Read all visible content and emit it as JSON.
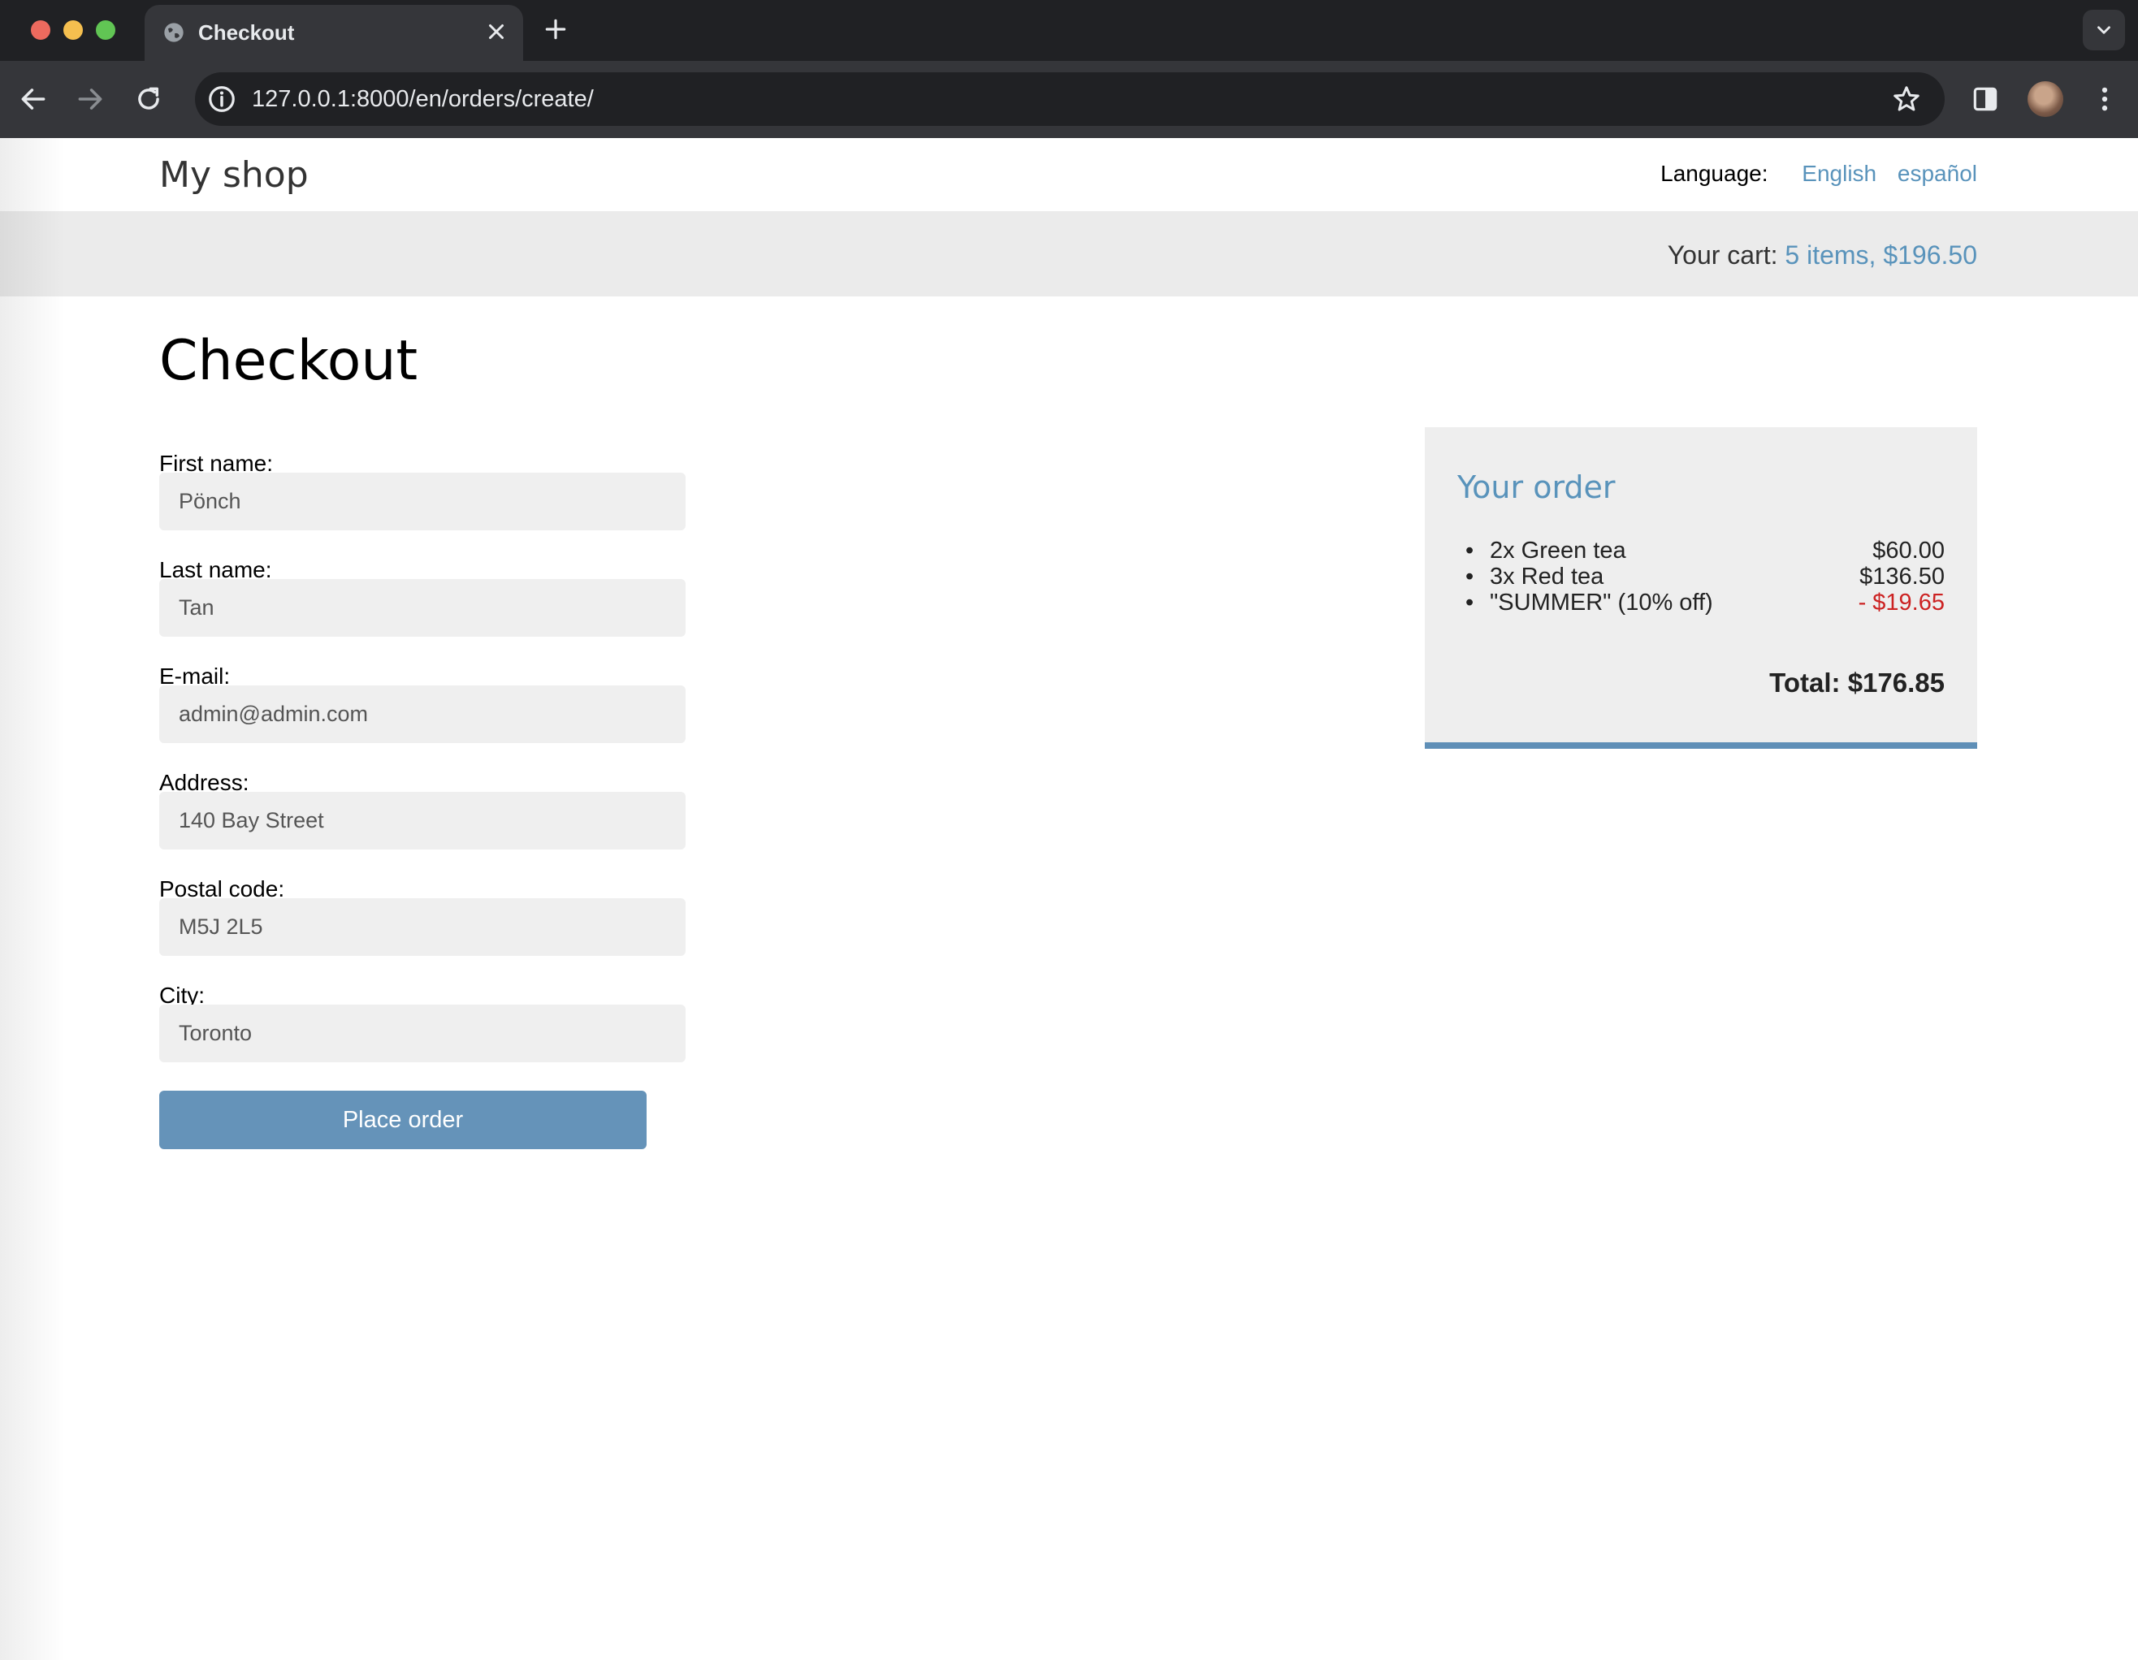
{
  "browser": {
    "tab_title": "Checkout",
    "url": "127.0.0.1:8000/en/orders/create/"
  },
  "site": {
    "logo": "My shop",
    "language_label": "Language:",
    "languages": [
      "English",
      "español"
    ],
    "cart_prefix": "Your cart:",
    "cart_summary": "5 items, $196.50"
  },
  "page": {
    "title": "Checkout"
  },
  "form": {
    "fields": [
      {
        "label": "First name:",
        "value": "Pönch"
      },
      {
        "label": "Last name:",
        "value": "Tan"
      },
      {
        "label": "E-mail:",
        "value": "admin@admin.com"
      },
      {
        "label": "Address:",
        "value": "140 Bay Street"
      },
      {
        "label": "Postal code:",
        "value": "M5J 2L5"
      },
      {
        "label": "City:",
        "value": "Toronto"
      }
    ],
    "submit_label": "Place order"
  },
  "order": {
    "title": "Your order",
    "items": [
      {
        "name": "2x Green tea",
        "price": "$60.00"
      },
      {
        "name": "3x Red tea",
        "price": "$136.50"
      },
      {
        "name": "\"SUMMER\" (10% off)",
        "price": "- $19.65"
      }
    ],
    "total": "Total: $176.85"
  },
  "colors": {
    "link": "#5993bb",
    "button": "#6593b9",
    "discount": "#cc2222"
  }
}
